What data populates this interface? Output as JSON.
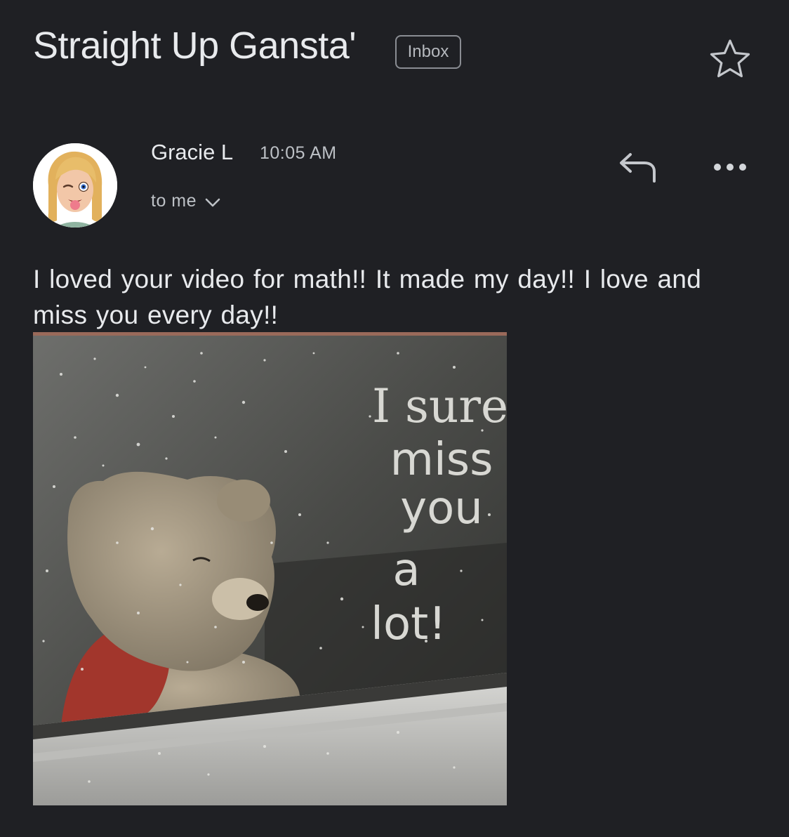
{
  "email": {
    "subject": "Straight Up Gansta'",
    "label": "Inbox",
    "star_icon": "star-outline-icon",
    "sender": {
      "name": "Gracie L",
      "time": "10:05 AM",
      "recipient_label": "to me",
      "avatar": "memoji-avatar"
    },
    "actions": {
      "reply_icon": "reply-icon",
      "more_icon": "more-horizontal-icon",
      "expand_icon": "chevron-down-icon"
    },
    "body": "I loved your video for math!! It made my day!! I love and miss you every day!!",
    "attachment": {
      "lines": [
        "I sure",
        "miss",
        "you",
        "a",
        "lot!"
      ]
    }
  },
  "colors": {
    "background": "#1f2024",
    "text_primary": "#e8eaed",
    "text_secondary": "#bdc1c6",
    "chip_border": "#8a8d93"
  }
}
